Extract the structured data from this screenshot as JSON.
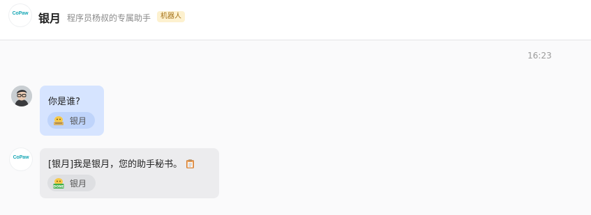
{
  "header": {
    "logo_text": "CoPaw",
    "title": "银月",
    "subtitle": "程序员杨叔的专属助手",
    "badge": "机器人"
  },
  "conversation": {
    "timestamp": "16:23",
    "messages": [
      {
        "sender": "user",
        "text": "你是谁?",
        "reaction": {
          "icon": "typing-emoji-icon",
          "label": "银月"
        }
      },
      {
        "sender": "bot",
        "avatar_text": "CoPaw",
        "text": "[银月]我是银月，您的助手秘书。",
        "trailing_icon": "clipboard-icon",
        "reaction": {
          "icon": "done-emoji-icon",
          "label": "银月"
        }
      }
    ]
  },
  "colors": {
    "user_bubble": "#d6e4ff",
    "bot_bubble": "#ececee",
    "brand": "#17a7b5",
    "badge_bg": "#fdf1cf"
  }
}
